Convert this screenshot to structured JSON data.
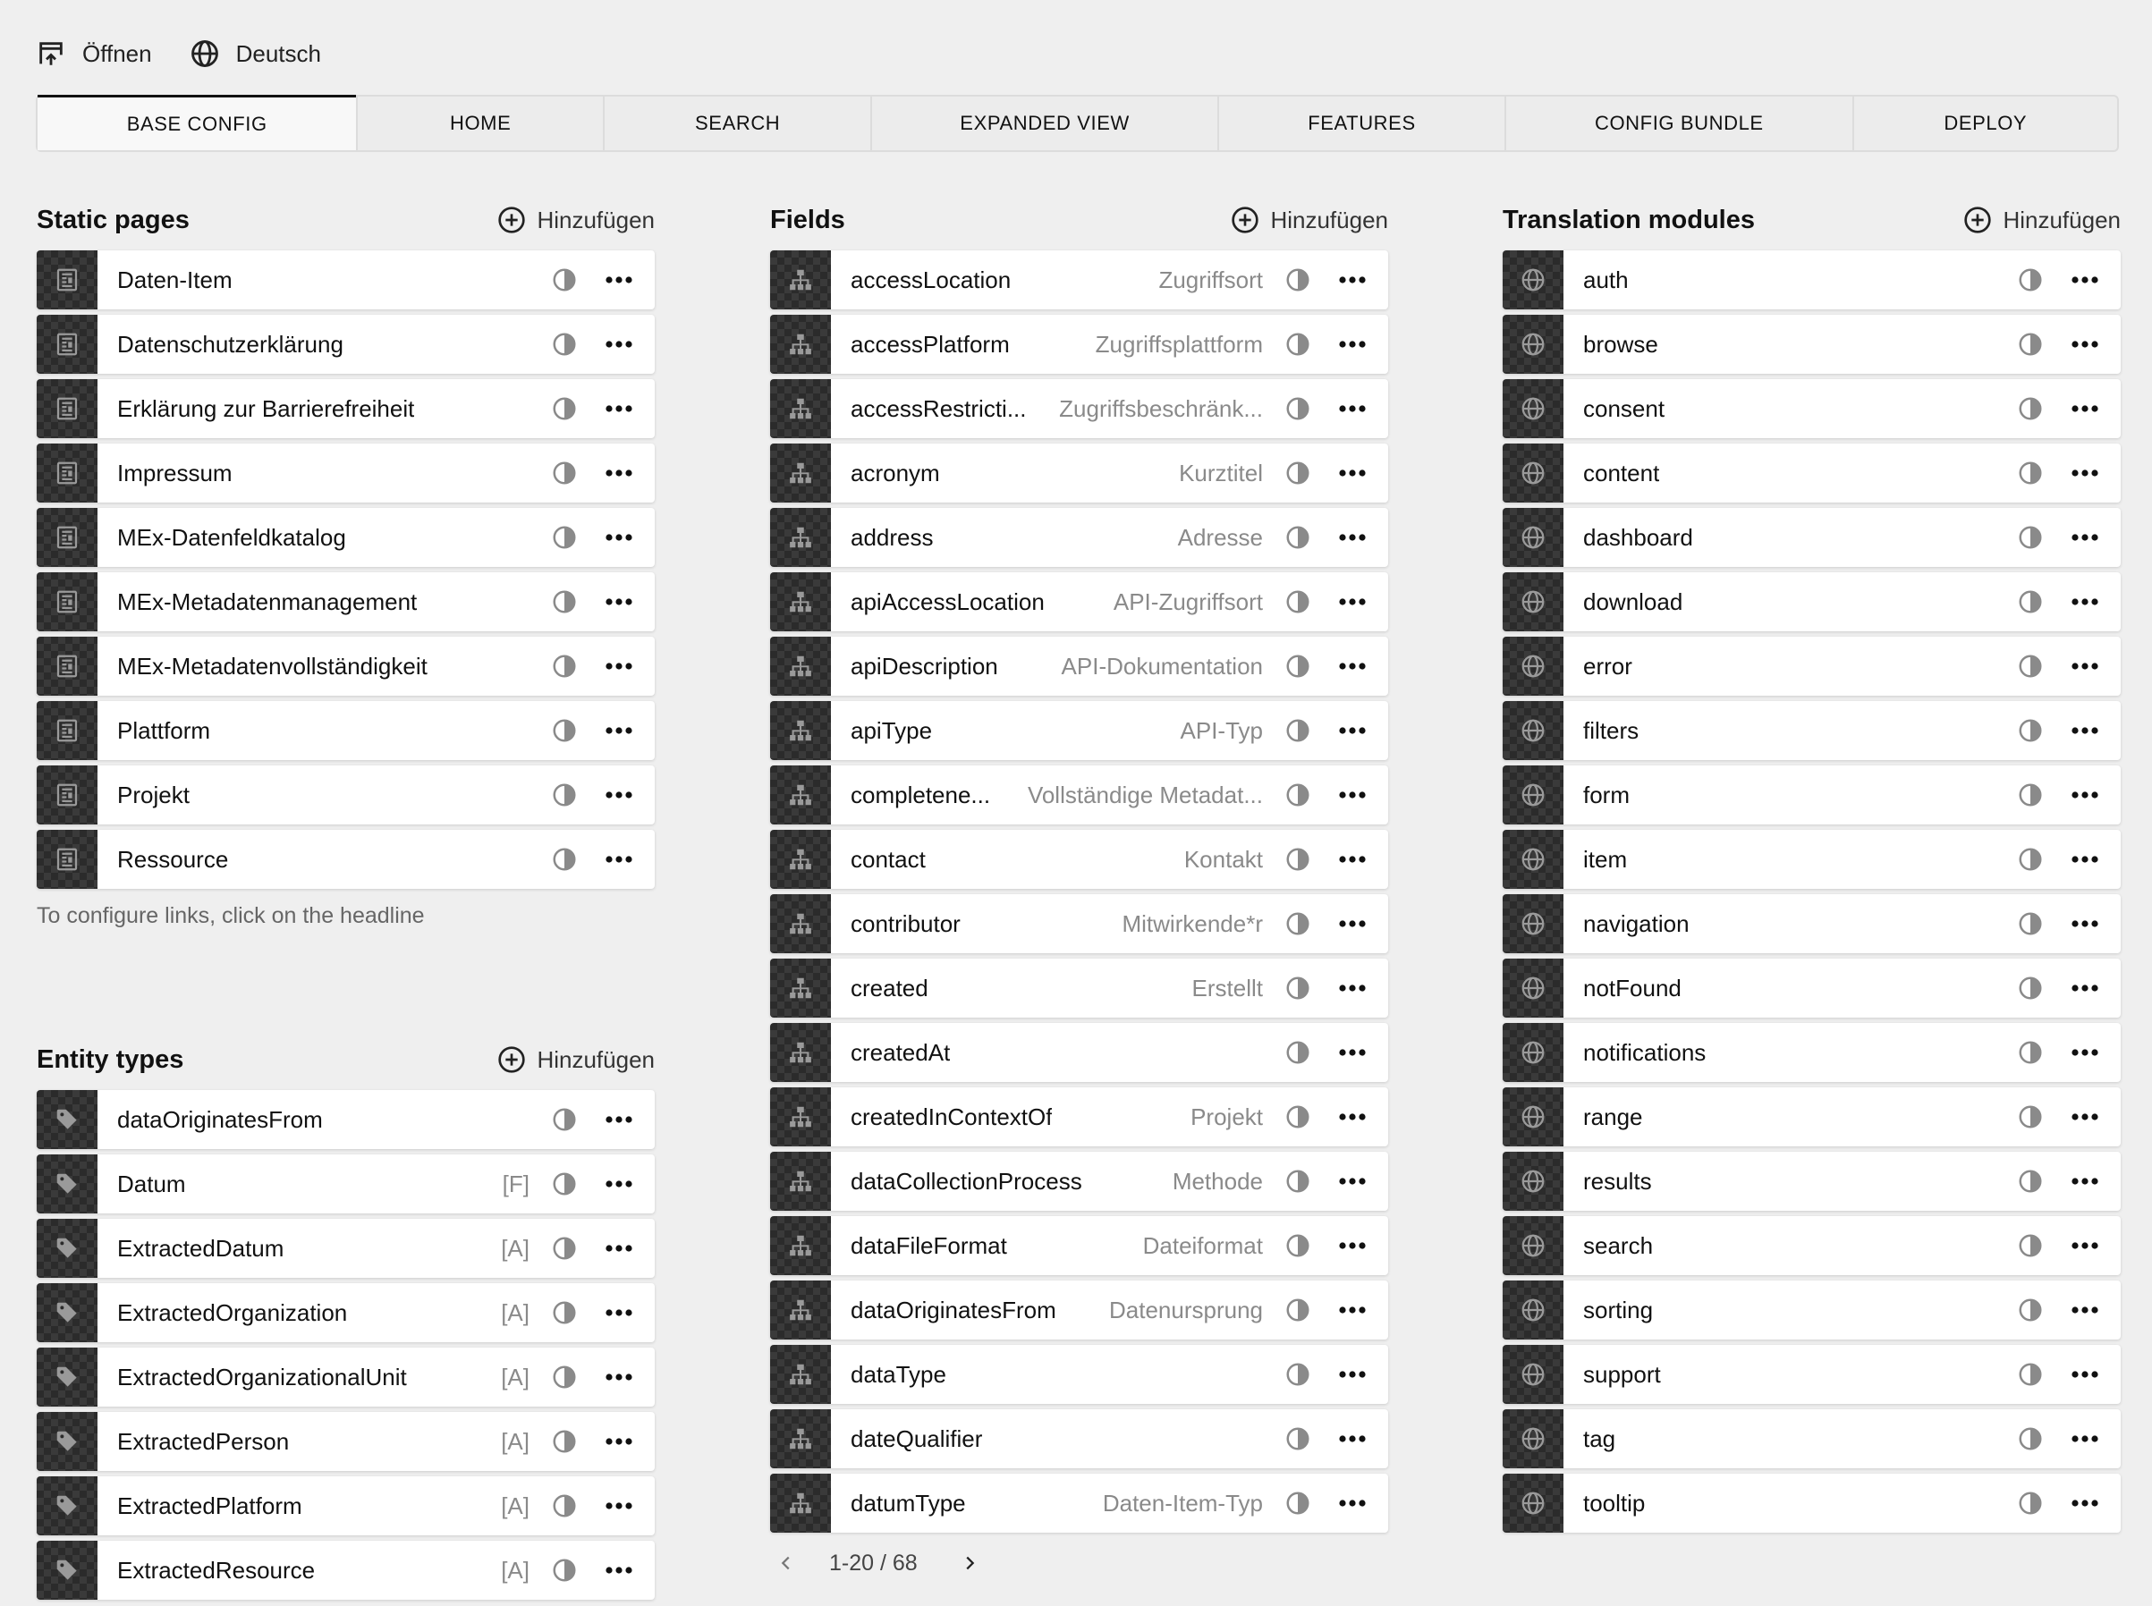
{
  "topbar": {
    "open_label": "Öffnen",
    "language_label": "Deutsch"
  },
  "tabs": [
    {
      "label": "BASE CONFIG",
      "active": true
    },
    {
      "label": "HOME"
    },
    {
      "label": "SEARCH"
    },
    {
      "label": "EXPANDED VIEW"
    },
    {
      "label": "FEATURES"
    },
    {
      "label": "CONFIG BUNDLE"
    },
    {
      "label": "DEPLOY"
    }
  ],
  "add_label": "Hinzufügen",
  "static_pages": {
    "title": "Static pages",
    "hint": "To configure links, click on the headline",
    "items": [
      {
        "label": "Daten-Item"
      },
      {
        "label": "Datenschutzerklärung"
      },
      {
        "label": "Erklärung zur Barrierefreiheit"
      },
      {
        "label": "Impressum"
      },
      {
        "label": "MEx-Datenfeldkatalog"
      },
      {
        "label": "MEx-Metadatenmanagement"
      },
      {
        "label": "MEx-Metadatenvollständigkeit"
      },
      {
        "label": "Plattform"
      },
      {
        "label": "Projekt"
      },
      {
        "label": "Ressource"
      }
    ]
  },
  "entity_types": {
    "title": "Entity types",
    "items": [
      {
        "label": "dataOriginatesFrom",
        "tag": ""
      },
      {
        "label": "Datum",
        "tag": "[F]"
      },
      {
        "label": "ExtractedDatum",
        "tag": "[A]"
      },
      {
        "label": "ExtractedOrganization",
        "tag": "[A]"
      },
      {
        "label": "ExtractedOrganizationalUnit",
        "tag": "[A]"
      },
      {
        "label": "ExtractedPerson",
        "tag": "[A]"
      },
      {
        "label": "ExtractedPlatform",
        "tag": "[A]"
      },
      {
        "label": "ExtractedResource",
        "tag": "[A]"
      }
    ]
  },
  "fields": {
    "title": "Fields",
    "pagination": "1-20 / 68",
    "items": [
      {
        "label": "accessLocation",
        "sub": "Zugriffsort"
      },
      {
        "label": "accessPlatform",
        "sub": "Zugriffsplattform"
      },
      {
        "label": "accessRestricti...",
        "sub": "Zugriffsbeschränk..."
      },
      {
        "label": "acronym",
        "sub": "Kurztitel"
      },
      {
        "label": "address",
        "sub": "Adresse"
      },
      {
        "label": "apiAccessLocation",
        "sub": "API-Zugriffsort"
      },
      {
        "label": "apiDescription",
        "sub": "API-Dokumentation"
      },
      {
        "label": "apiType",
        "sub": "API-Typ"
      },
      {
        "label": "completene...",
        "sub": "Vollständige Metadat..."
      },
      {
        "label": "contact",
        "sub": "Kontakt"
      },
      {
        "label": "contributor",
        "sub": "Mitwirkende*r"
      },
      {
        "label": "created",
        "sub": "Erstellt"
      },
      {
        "label": "createdAt",
        "sub": ""
      },
      {
        "label": "createdInContextOf",
        "sub": "Projekt"
      },
      {
        "label": "dataCollectionProcess",
        "sub": "Methode"
      },
      {
        "label": "dataFileFormat",
        "sub": "Dateiformat"
      },
      {
        "label": "dataOriginatesFrom",
        "sub": "Datenursprung"
      },
      {
        "label": "dataType",
        "sub": ""
      },
      {
        "label": "dateQualifier",
        "sub": ""
      },
      {
        "label": "datumType",
        "sub": "Daten-Item-Typ"
      }
    ]
  },
  "translation_modules": {
    "title": "Translation modules",
    "items": [
      {
        "label": "auth"
      },
      {
        "label": "browse"
      },
      {
        "label": "consent"
      },
      {
        "label": "content"
      },
      {
        "label": "dashboard"
      },
      {
        "label": "download"
      },
      {
        "label": "error"
      },
      {
        "label": "filters"
      },
      {
        "label": "form"
      },
      {
        "label": "item"
      },
      {
        "label": "navigation"
      },
      {
        "label": "notFound"
      },
      {
        "label": "notifications"
      },
      {
        "label": "range"
      },
      {
        "label": "results"
      },
      {
        "label": "search"
      },
      {
        "label": "sorting"
      },
      {
        "label": "support"
      },
      {
        "label": "tag"
      },
      {
        "label": "tooltip"
      }
    ]
  }
}
